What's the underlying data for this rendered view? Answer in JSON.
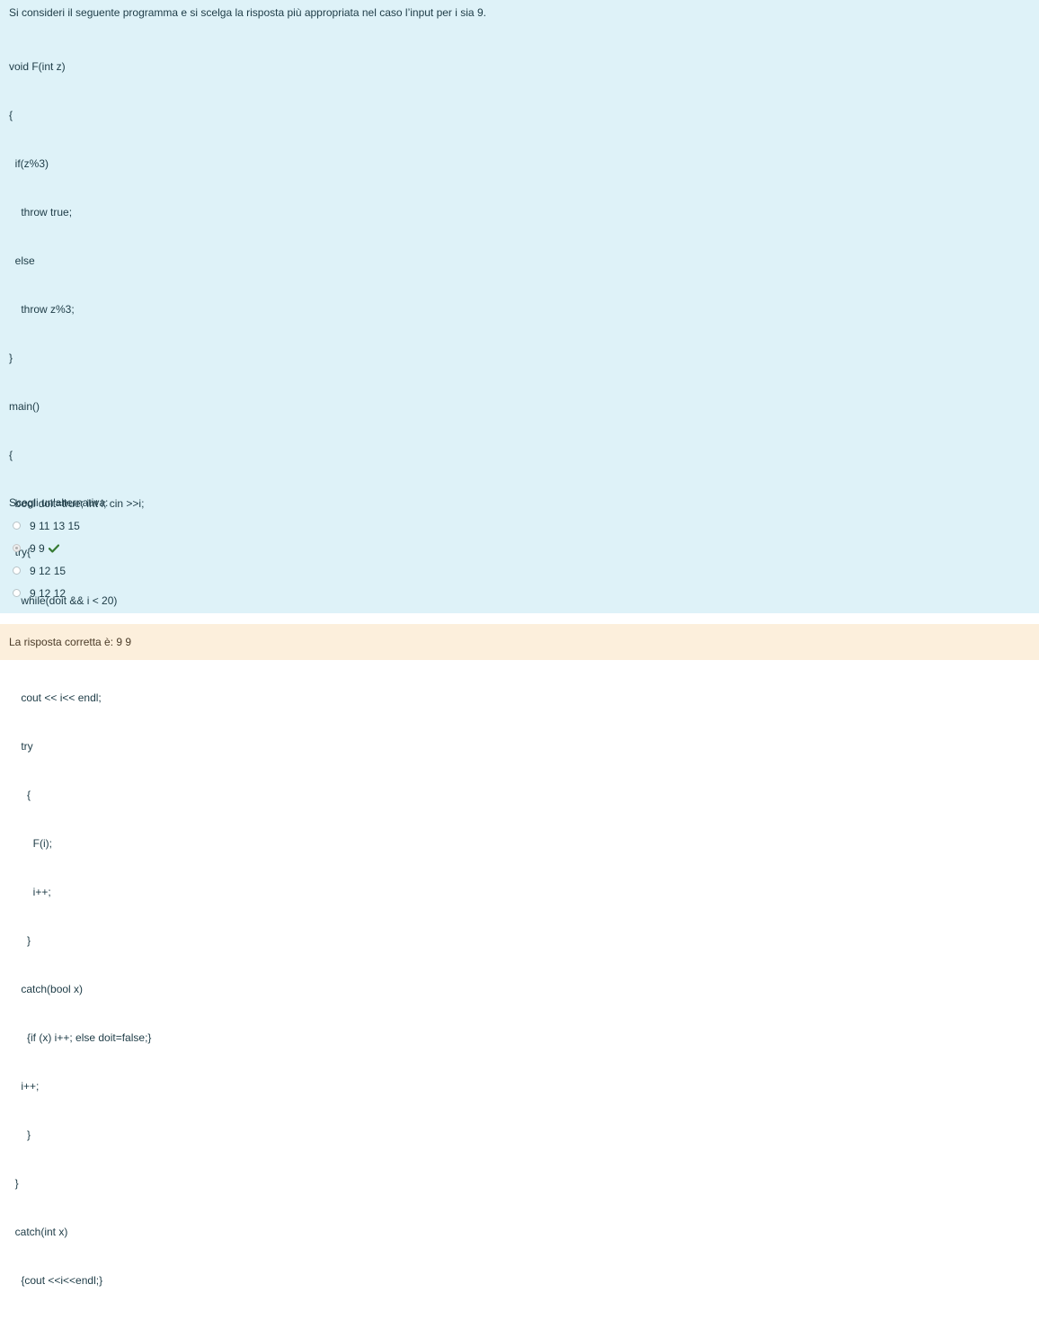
{
  "question": {
    "text": "Si consideri il seguente programma e si scelga la risposta più appropriata nel caso l’input per i sia 9.",
    "code_lines": [
      "void F(int z)",
      "{",
      "  if(z%3)",
      "    throw true;",
      "  else",
      "    throw z%3;",
      "}",
      "main()",
      "{",
      "  bool doit=true; int i; cin >>i;",
      "  try{",
      "    while(doit && i < 20)",
      "      {",
      "    cout << i<< endl;",
      "    try",
      "      {",
      "        F(i);",
      "        i++;",
      "      }",
      "    catch(bool x)",
      "      {if (x) i++; else doit=false;}",
      "    i++;",
      "      }",
      "  }",
      "  catch(int x)",
      "    {cout <<i<<endl;}",
      "}"
    ]
  },
  "prompt": "Scegli un'alternativa:",
  "answers": [
    {
      "label": "9 11 13 15",
      "selected": false,
      "correct": false
    },
    {
      "label": "9 9",
      "selected": true,
      "correct": true
    },
    {
      "label": "9 12  15",
      "selected": false,
      "correct": false
    },
    {
      "label": "9  12 12",
      "selected": false,
      "correct": false
    }
  ],
  "feedback": {
    "text": "La risposta corretta è: 9 9"
  },
  "colors": {
    "question_bg": "#def2f8",
    "feedback_bg": "#fcefdc",
    "correct_check": "#357a32"
  },
  "icons": {
    "correct": "check-icon"
  }
}
